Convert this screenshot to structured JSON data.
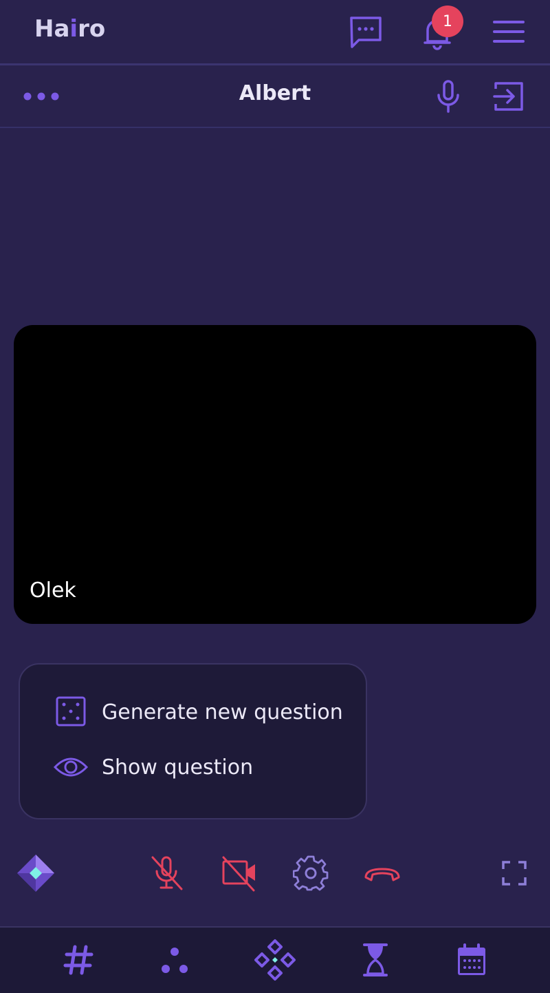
{
  "header": {
    "logo_prefix": "Ha",
    "logo_accent": "i",
    "logo_suffix": "ro",
    "notification_count": "1"
  },
  "subheader": {
    "title": "Albert"
  },
  "video": {
    "participant_name": "Olek"
  },
  "popup_menu": {
    "items": [
      {
        "label": "Generate new question",
        "icon": "dice-icon"
      },
      {
        "label": "Show question",
        "icon": "eye-icon"
      }
    ]
  },
  "call_controls": [
    {
      "icon": "diamond-logo-icon"
    },
    {
      "icon": "mic-off-icon",
      "state": "muted"
    },
    {
      "icon": "camera-off-icon",
      "state": "off"
    },
    {
      "icon": "gear-icon"
    },
    {
      "icon": "hang-up-icon"
    },
    {
      "icon": "fullscreen-icon"
    }
  ],
  "bottom_nav": [
    {
      "icon": "hashtag-icon"
    },
    {
      "icon": "dots-triangle-icon"
    },
    {
      "icon": "diamond-cluster-icon"
    },
    {
      "icon": "hourglass-icon"
    },
    {
      "icon": "calendar-icon"
    }
  ],
  "colors": {
    "background": "#29224d",
    "accent": "#7c5ae6",
    "danger": "#e5435d",
    "menu_bg": "#1e1a38",
    "nav_bg": "#1d1937"
  }
}
